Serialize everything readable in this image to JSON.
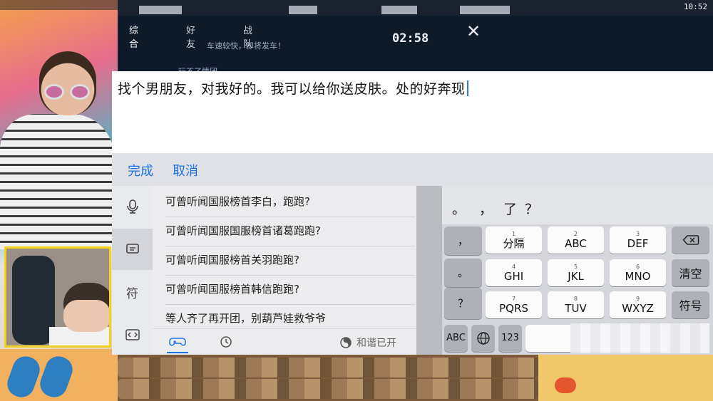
{
  "game": {
    "tabs": [
      "综合",
      "好友",
      "战队"
    ],
    "message": "车速较快，即将发车！",
    "message2": "玩不了情团",
    "timer": "02:58",
    "close_symbol": "✕",
    "system_time": "10:52"
  },
  "editor": {
    "text": "找个男朋友，对我好的。我可以给你送皮肤。处的好奔现"
  },
  "actions": {
    "done": "完成",
    "cancel": "取消"
  },
  "side_toolbar": {
    "items": [
      {
        "name": "voice",
        "glyph": "🎙"
      },
      {
        "name": "phrases",
        "glyph": "▤"
      },
      {
        "name": "symbols",
        "glyph": "符"
      },
      {
        "name": "code",
        "glyph": "‹/›"
      }
    ]
  },
  "phrases": [
    "可曾听闻国服榜首李白，跑跑?",
    "可曾听闻国服国服榜首诸葛跑跑?",
    "可曾听闻国服榜首关羽跑跑?",
    "可曾听闻国服榜首韩信跑跑?",
    "等人齐了再开团，别葫芦娃救爷爷"
  ],
  "phrase_tabs": {
    "game_icon": "🎮",
    "clock_icon": "◷",
    "harmony_icon": "◔",
    "harmony_label": "和谐已开"
  },
  "keyboard": {
    "candidates": [
      "。",
      "，",
      "了",
      "？"
    ],
    "punct_keys": [
      "，",
      "。",
      "？"
    ],
    "rows": [
      [
        {
          "num": "1",
          "label": "分隔"
        },
        {
          "num": "2",
          "label": "ABC"
        },
        {
          "num": "3",
          "label": "DEF"
        }
      ],
      [
        {
          "num": "4",
          "label": "GHI"
        },
        {
          "num": "5",
          "label": "JKL"
        },
        {
          "num": "6",
          "label": "MNO"
        }
      ],
      [
        {
          "num": "7",
          "label": "PQRS"
        },
        {
          "num": "8",
          "label": "TUV"
        },
        {
          "num": "9",
          "label": "WXYZ"
        }
      ]
    ],
    "backspace": "⌫",
    "clear": "清空",
    "symbols": "符号",
    "abc": "ABC",
    "globe": "🌐",
    "num": "123"
  }
}
